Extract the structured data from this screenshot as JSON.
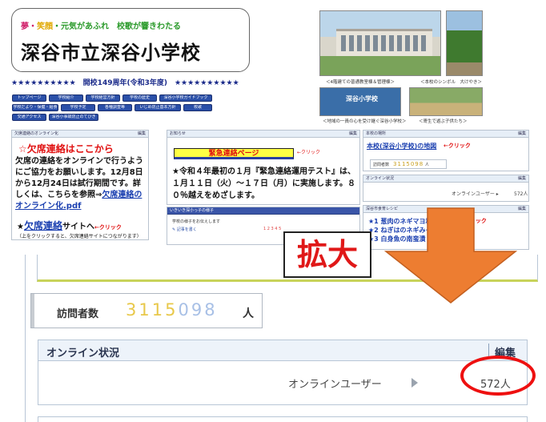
{
  "header": {
    "slogan_1": "夢・",
    "slogan_2": "笑顔",
    "slogan_3": "・元気があふれ　校歌が響きわたる",
    "school_title": "深谷市立深谷小学校",
    "anniversary": "★★★★★★★★★★　開校149周年(令和3年度)　★★★★★★★★★★"
  },
  "photos": {
    "sign_text": "深谷小学校",
    "captions": [
      "＜4階建ての普通教室棟＆管理棟＞",
      "＜本校のシンボル　大けやき＞",
      "＜地域の一員の心を受け継ぐ深谷小学校＞",
      "＜寄生で遊ぶ子供たち＞"
    ]
  },
  "nav": {
    "items": [
      "トップページ",
      "学校紹介",
      "学校経営方針",
      "学校の歴史",
      "深谷小学校ガイドブック",
      "学校だより・保健・給食",
      "学校予定",
      "各種調査等",
      "いじめ防止基本方針",
      "校歌",
      "交通アクセス",
      "深谷小事故防止のてびき"
    ]
  },
  "absence": {
    "panel_title": "欠席連絡のオンライン化",
    "edit": "編集",
    "title": "☆欠席連絡はここから",
    "body_prefix": "欠席の連絡をオンラインで行うようにご協力をお願いします。12月8日から12月24日は試行期間です。詳しくは、こちらを参照⇒",
    "body_link": "欠席連絡のオンライン化.pdf",
    "site_star": "★",
    "site_big": "欠席連絡",
    "site_rest": "サイトへ",
    "site_click": "←クリック",
    "note": "（上をクリックすると、欠席連絡サイトにつながります）"
  },
  "notice": {
    "panel_title": "お知らせ",
    "edit": "編集",
    "banner": "緊急連絡ページ",
    "click": "←クリック",
    "body": "★令和４年最初の１月『緊急連絡運用テスト』は、１月１１日（火）～１７日（月）に実施します。８０％越えをめざします。"
  },
  "kids": {
    "panel_title": "いきいき深小っ子の様子",
    "sub": "学校の様子をお伝えします",
    "write": "✎ 記事を書く",
    "pages": "1 2 3 4 5"
  },
  "place": {
    "panel_title": "本校の場所",
    "edit": "編集",
    "link": "本校(深谷小学校)の地図",
    "click": "←クリック",
    "visit_label": "訪問者数",
    "visit_digits": "3115098",
    "visit_unit": "人"
  },
  "online_small": {
    "panel_title": "オンライン状況",
    "edit": "編集",
    "user_label": "オンラインユーザー ▸",
    "count": "572人"
  },
  "recipe": {
    "panel_title": "深谷市食育レシピ",
    "edit": "編集",
    "text": "★1 葱肉のネギマヨ和え\n★2 ねぎはのネギみそ焼\n★3 白身魚の南蛮漬",
    "click": "←クリック"
  },
  "zoom_label": "拡大",
  "zoomed": {
    "visit_label": "訪問者数",
    "visit_digits_1": "3",
    "visit_digits_2": "115",
    "visit_digits_3": "098",
    "visit_unit": "人",
    "online_title": "オンライン状況",
    "online_edit": "編集",
    "online_user_label": "オンラインユーザー",
    "online_count": "572人"
  },
  "colors": {
    "accent_red": "#ee1010",
    "arrow_orange": "#ed7d31",
    "nav_blue": "#2a4fa8"
  }
}
